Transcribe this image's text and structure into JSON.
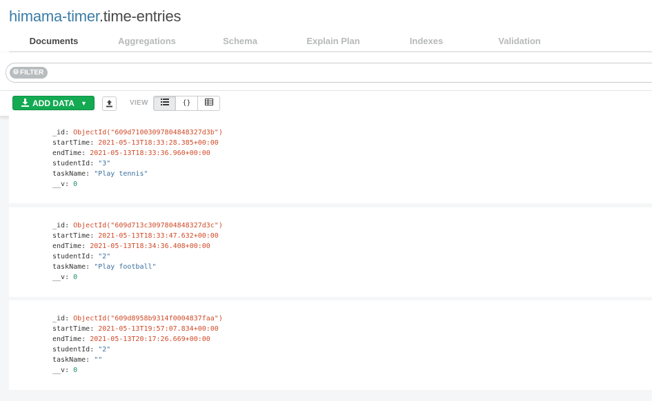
{
  "header": {
    "database": "himama-timer",
    "collection": ".time-entries"
  },
  "tabs": [
    {
      "label": "Documents",
      "active": true
    },
    {
      "label": "Aggregations",
      "active": false
    },
    {
      "label": "Schema",
      "active": false
    },
    {
      "label": "Explain Plan",
      "active": false
    },
    {
      "label": "Indexes",
      "active": false
    },
    {
      "label": "Validation",
      "active": false
    }
  ],
  "filter": {
    "pill_label": "FILTER",
    "value": ""
  },
  "toolbar": {
    "add_data_label": "ADD DATA",
    "add_data_icon": "download-icon",
    "import_icon": "upload-icon",
    "view_label": "VIEW",
    "views": [
      {
        "name": "list-view-icon",
        "glyph": "☰",
        "active": true
      },
      {
        "name": "json-view-icon",
        "glyph": "{}",
        "active": false
      },
      {
        "name": "table-view-icon",
        "glyph": "▦",
        "active": false
      }
    ]
  },
  "colors": {
    "accent": "#13aa52",
    "db_name": "#3b7ca6",
    "oid": "#cf4a28",
    "string": "#3b6f9e",
    "number": "#1a8e6b"
  },
  "documents": [
    {
      "fields": [
        {
          "key": "_id",
          "value": "ObjectId(\"609d71003097804848327d3b\")",
          "type": "oid"
        },
        {
          "key": "startTime",
          "value": "2021-05-13T18:33:28.385+00:00",
          "type": "date"
        },
        {
          "key": "endTime",
          "value": "2021-05-13T18:33:36.960+00:00",
          "type": "date"
        },
        {
          "key": "studentId",
          "value": "\"3\"",
          "type": "str"
        },
        {
          "key": "taskName",
          "value": "\"Play tennis\"",
          "type": "str"
        },
        {
          "key": "__v",
          "value": "0",
          "type": "num"
        }
      ]
    },
    {
      "fields": [
        {
          "key": "_id",
          "value": "ObjectId(\"609d713c3097804848327d3c\")",
          "type": "oid"
        },
        {
          "key": "startTime",
          "value": "2021-05-13T18:33:47.632+00:00",
          "type": "date"
        },
        {
          "key": "endTime",
          "value": "2021-05-13T18:34:36.408+00:00",
          "type": "date"
        },
        {
          "key": "studentId",
          "value": "\"2\"",
          "type": "str"
        },
        {
          "key": "taskName",
          "value": "\"Play football\"",
          "type": "str"
        },
        {
          "key": "__v",
          "value": "0",
          "type": "num"
        }
      ]
    },
    {
      "fields": [
        {
          "key": "_id",
          "value": "ObjectId(\"609d8958b9314f0004837faa\")",
          "type": "oid"
        },
        {
          "key": "startTime",
          "value": "2021-05-13T19:57:07.834+00:00",
          "type": "date"
        },
        {
          "key": "endTime",
          "value": "2021-05-13T20:17:26.669+00:00",
          "type": "date"
        },
        {
          "key": "studentId",
          "value": "\"2\"",
          "type": "str"
        },
        {
          "key": "taskName",
          "value": "\"\"",
          "type": "str"
        },
        {
          "key": "__v",
          "value": "0",
          "type": "num"
        }
      ]
    }
  ]
}
